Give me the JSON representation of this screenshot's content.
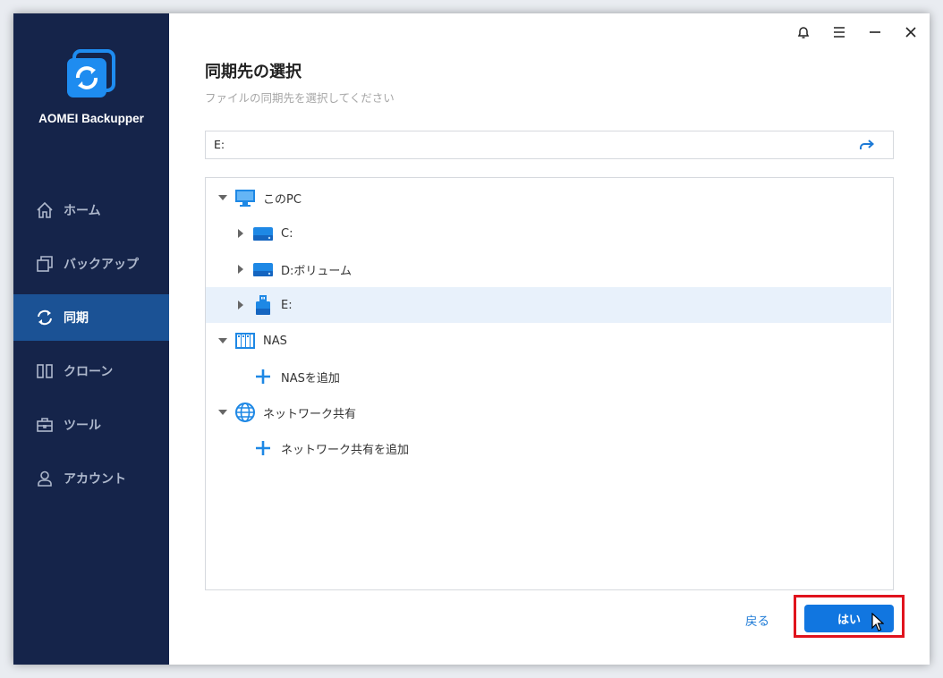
{
  "app": {
    "name": "AOMEI Backupper"
  },
  "sidebar": {
    "items": [
      {
        "label": "ホーム",
        "icon": "home-icon",
        "active": false
      },
      {
        "label": "バックアップ",
        "icon": "backup-icon",
        "active": false
      },
      {
        "label": "同期",
        "icon": "sync-icon",
        "active": true
      },
      {
        "label": "クローン",
        "icon": "clone-icon",
        "active": false
      },
      {
        "label": "ツール",
        "icon": "tools-icon",
        "active": false
      },
      {
        "label": "アカウント",
        "icon": "account-icon",
        "active": false
      }
    ]
  },
  "titlebar": {
    "buttons": [
      "bell-icon",
      "menu-icon",
      "minimize-icon",
      "close-icon"
    ]
  },
  "main": {
    "title": "同期先の選択",
    "subtitle": "ファイルの同期先を選択してください",
    "path": {
      "value": "E:"
    },
    "tree": [
      {
        "label": "このPC",
        "icon": "monitor-icon",
        "expanded": true,
        "level": 0
      },
      {
        "label": "C:",
        "icon": "drive-icon",
        "expanded": false,
        "level": 1
      },
      {
        "label": "D:ボリューム",
        "icon": "drive-icon",
        "expanded": false,
        "level": 1
      },
      {
        "label": "E:",
        "icon": "usb-drive-icon",
        "expanded": false,
        "level": 1,
        "selected": true
      },
      {
        "label": "NAS",
        "icon": "nas-icon",
        "expanded": true,
        "level": 0
      },
      {
        "label": "NASを追加",
        "icon": "plus-icon",
        "level": 1
      },
      {
        "label": "ネットワーク共有",
        "icon": "globe-icon",
        "expanded": true,
        "level": 0
      },
      {
        "label": "ネットワーク共有を追加",
        "icon": "plus-icon",
        "level": 1
      }
    ]
  },
  "footer": {
    "back_label": "戻る",
    "ok_label": "はい"
  },
  "colors": {
    "sidebar": "#15244a",
    "active": "#1b5295",
    "accent": "#1176e0",
    "highlight": "#e0131d"
  }
}
